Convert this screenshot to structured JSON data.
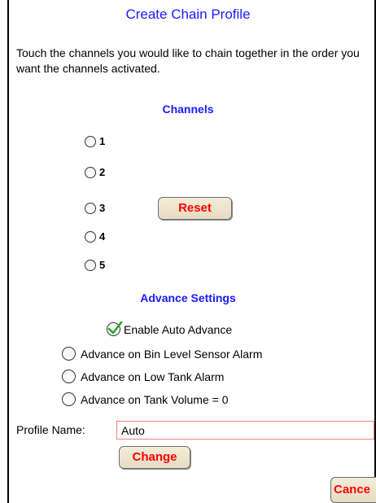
{
  "title": "Create Chain Profile",
  "instructions": "Touch the channels you would like to chain together in the order you want the channels activated.",
  "channels": {
    "heading": "Channels",
    "items": [
      "1",
      "2",
      "3",
      "4",
      "5"
    ],
    "reset_label": "Reset"
  },
  "advance": {
    "heading": "Advance Settings",
    "enable_auto_label": "Enable Auto Advance",
    "enable_auto_checked": true,
    "options": [
      "Advance on Bin Level Sensor Alarm",
      "Advance on Low Tank Alarm",
      "Advance on Tank Volume = 0"
    ]
  },
  "profile": {
    "label": "Profile Name:",
    "value": "Auto",
    "change_label": "Change"
  },
  "cancel_label": "Cance",
  "colors": {
    "heading": "#1a1aff",
    "button_text": "#ff0000",
    "button_bg": "#efe6cf",
    "check": "#22aa22"
  }
}
